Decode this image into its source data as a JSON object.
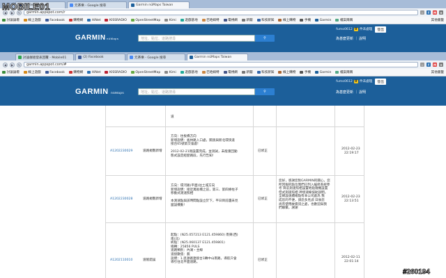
{
  "watermark": {
    "brand": "MOBILE01",
    "id": "#260194"
  },
  "back_window": {
    "tabs": [
      {
        "label": "(2) Facebook"
      },
      {
        "label": "元茶樂 - Google 搜尋"
      },
      {
        "label": "Garmin nüMaps Taiwan"
      }
    ],
    "url": "garmin.appspot.com/r",
    "bookmarks": [
      "討論論壇",
      "線上遊戲",
      "Facebook",
      "購物網",
      "HiNet",
      "KISSRADIO",
      "OpenStreetMap",
      "Kimi",
      "遊戲基地",
      "巴哈姆特",
      "電視網",
      "新聞",
      "科技新知",
      "線上購物",
      "手機",
      "Garmin",
      "檔案兩兩"
    ],
    "other_bookmarks": "其他書籤",
    "user": "fumo0612",
    "badge_count": "0",
    "notices": "件未處理",
    "logout": "登出",
    "search_placeholder": "地址、點位、道路搜尋",
    "links": "為甚麼更新 ｜ 說明"
  },
  "front_window": {
    "tabs": [
      {
        "label": "討論群組發表回覆 - Mobile01"
      },
      {
        "label": "(2) Facebook"
      },
      {
        "label": "元茶樂 - Google 搜尋"
      },
      {
        "label": "Garmin nüMaps Taiwan"
      }
    ],
    "url": "garmin.appspot.com/#",
    "bookmarks": [
      "討論論壇",
      "線上遊戲",
      "Facebook",
      "購物網",
      "HiNet",
      "KISSRADIO",
      "OpenStreetMap",
      "Kimi",
      "遊戲基地",
      "巴哈姆特",
      "電視網",
      "新聞",
      "科技新知",
      "線上購物",
      "手機",
      "Garmin",
      "檔案兩兩"
    ],
    "other_bookmarks": "其他書籤",
    "user": "fumo0612",
    "badge_count": "0",
    "notices": "件未處理",
    "logout": "登出",
    "logo": "GARMIN",
    "logo_sub": "nüMaps",
    "search_placeholder": "地址、點位、道路搜尋",
    "links": "為甚麼更新 ｜ 說明"
  },
  "table": {
    "top_fragment": "道",
    "rows": [
      {
        "id": "A1202230029",
        "type": "道路規劃新增",
        "desc": [
          "方向：往板橋方向",
          "新增說明：板林路入口處，關渡與新北環快道",
          "接台65號第交會處!",
          "",
          "2012-02-21剛設置完成，並測試，未能重回動",
          "態式設定經歷路段，先行告知!"
        ],
        "status": "已修正",
        "reply": [],
        "date": "2012-02-23",
        "time": "22:19:17"
      },
      {
        "id": "A1202230028",
        "type": "道路規劃新增",
        "desc": [
          "方向：環河路(平面)往土城方向",
          "新增說明：接近萬板橋之前，第三、第四條柱子",
          "移動式測速照相",
          "",
          "本測速點與該時間點設立於下，平日目前還未見",
          "國設機動!"
        ],
        "status": "已修正",
        "reply": [
          "您好，感謝您對GARMIN的關心，您",
          "所回報的點位我們已列入編修系統參",
          "考 目前測速照相設置地點隨機設置",
          "但式測速照相 神境速線協助說明。",
          "全網設速續確點有本公司處為 我",
          "成您的不便，請您多見諒 日後您",
          "尚有使用故資訊之處，也歡迎與我",
          "們聯繫，謝謝"
        ],
        "date": "2012-02-23",
        "time": "22:13:51"
      },
      {
        "id": "A1202110010",
        "type": "道帳錯誤",
        "desc": [
          "起點：(N25.057213 E121.459860) 南東(西)",
          "南(北)",
          "終點：(N25.060137 E121.459801)",
          "緯轉：25856 PULS",
          "道路類別：內湖・主線",
          "道接數值：無",
          "說明：1.思源路連接台1轉中山南路，導航只會",
          "導引往北平面道路。"
        ],
        "status": "已修正",
        "reply": [],
        "date": "2012-02-11",
        "time": "22:01:14"
      }
    ]
  }
}
